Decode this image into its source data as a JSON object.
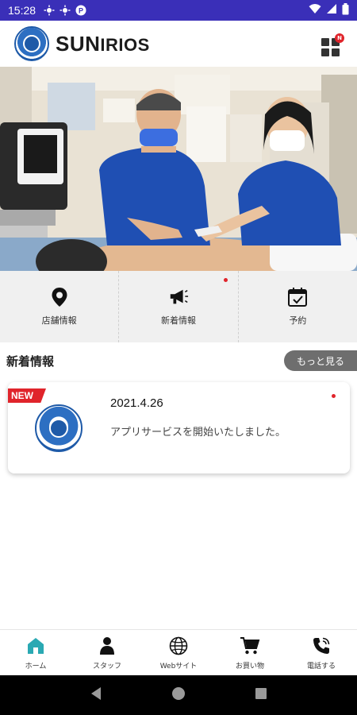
{
  "status_bar": {
    "time": "15:28",
    "left_icons": [
      "sun-icon",
      "sun-icon",
      "p-icon"
    ],
    "right_icons": [
      "wifi-icon",
      "signal-icon",
      "battery-icon"
    ]
  },
  "header": {
    "brand_prefix": "SUN",
    "brand_suffix": "IRIOS",
    "menu_badge": "N"
  },
  "hero": {
    "image": "clinic-treatment-photo"
  },
  "quick_menu": [
    {
      "label": "店舗情報",
      "icon": "location-pin-icon",
      "has_dot": false
    },
    {
      "label": "新着情報",
      "icon": "megaphone-icon",
      "has_dot": true
    },
    {
      "label": "予約",
      "icon": "calendar-check-icon",
      "has_dot": false
    }
  ],
  "news": {
    "title": "新着情報",
    "more_label": "もっと見る",
    "items": [
      {
        "badge": "NEW",
        "date": "2021.4.26",
        "text": "アプリサービスを開始いたしました。",
        "unread": true
      }
    ]
  },
  "bottom_nav": [
    {
      "label": "ホーム",
      "icon": "home-icon",
      "active": true
    },
    {
      "label": "スタッフ",
      "icon": "person-icon",
      "active": false
    },
    {
      "label": "Webサイト",
      "icon": "globe-icon",
      "active": false
    },
    {
      "label": "お買い物",
      "icon": "cart-icon",
      "active": false
    },
    {
      "label": "電話する",
      "icon": "phone-icon",
      "active": false
    }
  ],
  "colors": {
    "status_bar": "#3a2fb8",
    "accent_teal": "#2aa9b3",
    "badge_red": "#e0242b",
    "brand_blue": "#1e5aa8"
  }
}
